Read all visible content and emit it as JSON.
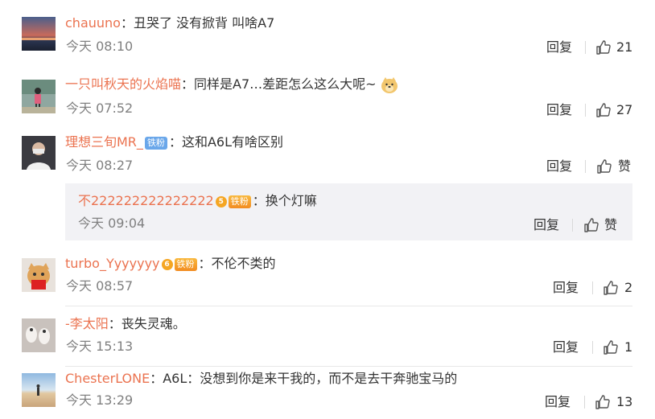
{
  "actions": {
    "reply_label": "回复"
  },
  "comments": [
    {
      "username": "chauuno",
      "separator": "：",
      "text": "丑哭了 没有掀背 叫啥A7",
      "time": "今天 08:10",
      "likes": "21"
    },
    {
      "username": "一只叫秋天的火焰喵",
      "separator": "：",
      "text": "同样是A7…差距怎么这么大呢~",
      "emoji": "doge-emoji",
      "time": "今天 07:52",
      "likes": "27"
    },
    {
      "username": "理想三旬MR_",
      "badge": "铁粉",
      "separator": "：",
      "text": "这和A6L有啥区别",
      "time": "今天 08:27",
      "likes": "赞",
      "sub_reply": {
        "username": "不222222222222222",
        "badge_level": "5",
        "badge": "铁粉",
        "separator": "：",
        "text": "换个灯嘛",
        "time": "今天 09:04",
        "likes": "赞"
      }
    },
    {
      "username": "turbo_Yyyyyyy",
      "badge_level": "6",
      "badge": "铁粉",
      "separator": "：",
      "text": "不伦不类的",
      "time": "今天 08:57",
      "likes": "2"
    },
    {
      "username": "-李太阳",
      "separator": "：",
      "text": "丧失灵魂。",
      "time": "今天 15:13",
      "likes": "1"
    },
    {
      "username": "ChesterLONE",
      "separator": "：",
      "text": "A6L：没想到你是来干我的，而不是去干奔驰宝马的",
      "time": "今天 13:29",
      "likes": "13"
    }
  ],
  "colors": {
    "username": "#eb7350",
    "time": "#808080",
    "badge_blue": "#6aa7ea",
    "badge_gold": "#f5a623"
  }
}
